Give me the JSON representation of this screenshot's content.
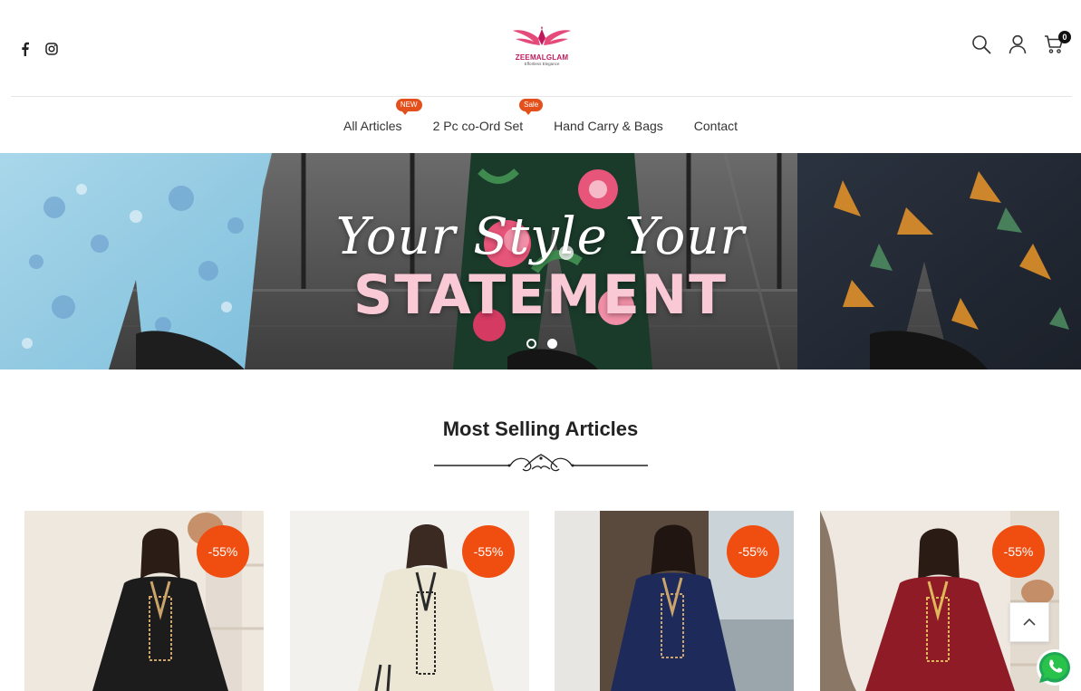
{
  "header": {
    "brand": {
      "name": "ZEEMALGLAM",
      "tagline": "Effortless Elegance"
    },
    "social": [
      {
        "name": "facebook-icon"
      },
      {
        "name": "instagram-icon"
      }
    ],
    "actions": {
      "search_icon": "search-icon",
      "account_icon": "user-icon",
      "cart_icon": "cart-icon",
      "cart_count": "0"
    }
  },
  "nav": {
    "items": [
      {
        "label": "All Articles",
        "badge": "NEW"
      },
      {
        "label": "2 Pc co-Ord Set",
        "badge": "Sale"
      },
      {
        "label": "Hand Carry & Bags",
        "badge": ""
      },
      {
        "label": "Contact",
        "badge": ""
      }
    ]
  },
  "hero": {
    "script_line": "Your Style Your",
    "bold_line": "STATEMENT",
    "slides": {
      "count": 2,
      "active_index": 0
    }
  },
  "section": {
    "title": "Most Selling Articles"
  },
  "products": [
    {
      "badge": "-55%",
      "dress_color": "#1c1c1c"
    },
    {
      "badge": "-55%",
      "dress_color": "#ece6d4"
    },
    {
      "badge": "-55%",
      "dress_color": "#1e2a5a"
    },
    {
      "badge": "-55%",
      "dress_color": "#8e1b26"
    }
  ],
  "colors": {
    "accent": "#f04e10",
    "badge_orange": "#e4501c",
    "brand_pink": "#c2185b"
  },
  "floating": {
    "back_to_top_icon": "chevron-up-icon",
    "chat_icon": "whatsapp-icon"
  }
}
